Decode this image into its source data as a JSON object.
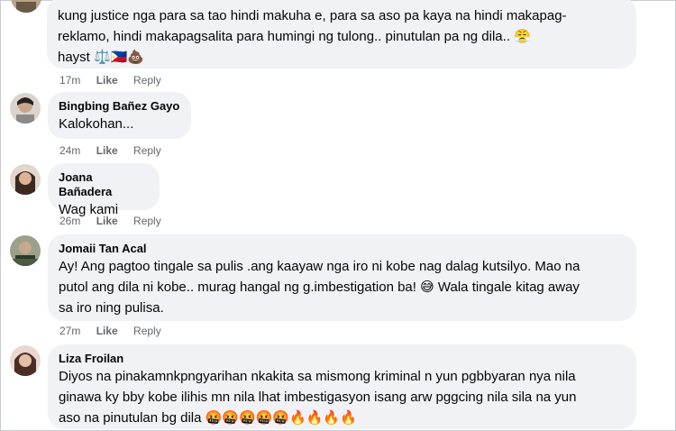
{
  "comments": [
    {
      "author": "",
      "lines": [
        "kung justice nga para sa tao hindi makuha e, para sa aso pa kaya na hindi makapag-",
        "reklamo, hindi makapagsalita para humingi ng tulong.. pinutulan pa ng dila.. 😤",
        "hayst ⚖️🇵🇭💩"
      ],
      "time": "17m",
      "like": "Like",
      "reply": "Reply"
    },
    {
      "author": "Bingbing Bañez Gayo",
      "lines": [
        "Kalokohan..."
      ],
      "time": "24m",
      "like": "Like",
      "reply": "Reply"
    },
    {
      "author": "Joana Bañadera",
      "lines": [
        "Wag kami"
      ],
      "time": "26m",
      "like": "Like",
      "reply": "Reply"
    },
    {
      "author": "Jomaii Tan Acal",
      "lines": [
        "Ay! Ang pagtoo tingale sa pulis .ang kaayaw nga iro ni kobe nag dalag kutsilyo. Mao na",
        "putol ang dila ni kobe.. murag hangal ng g.imbestigation ba! 😅 Wala tingale kitag away",
        "sa iro ning pulisa."
      ],
      "time": "27m",
      "like": "Like",
      "reply": "Reply"
    },
    {
      "author": "Liza Froilan",
      "lines": [
        "Diyos na pinakamnkpngyarihan nkakita sa mismong kriminal n yun pgbbyaran nya nila",
        "ginawa ky bby kobe ilihis mn nila lhat imbestigasyon isang arw pggcing nila sila na yun",
        "aso na pinutulan bg dila 🤬🤬🤬🤬🤬🔥🔥🔥🔥"
      ]
    }
  ],
  "colors": {
    "bubble": "#f0f2f5",
    "meta": "#65676b",
    "text": "#050505"
  }
}
